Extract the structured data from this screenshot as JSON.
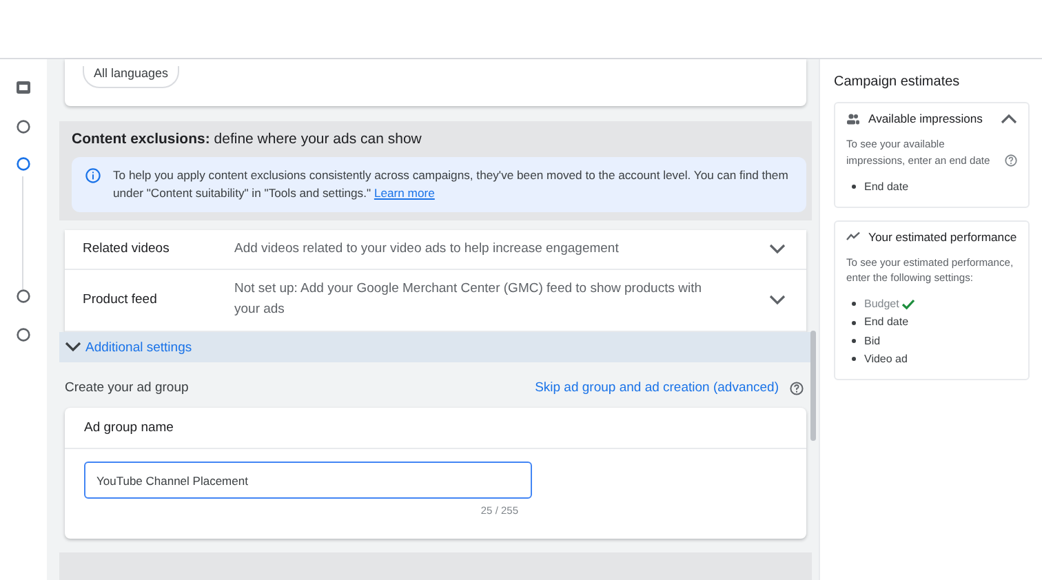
{
  "stepper": {
    "steps": [
      {
        "kind": "icon",
        "selected": false
      },
      {
        "kind": "circle",
        "selected": false
      },
      {
        "kind": "circle",
        "selected": true
      },
      {
        "kind": "circle",
        "selected": false
      },
      {
        "kind": "circle",
        "selected": false
      }
    ]
  },
  "languages": {
    "chip": "All languages"
  },
  "content_exclusions": {
    "title": "**Content exclusions:** define where your ads can show",
    "notice": "To help you apply content exclusions consistently across campaigns, they've been moved to the account level. You can find them under \"Content suitability\" in \"Tools and settings.\"",
    "link": "Learn more"
  },
  "settings_rows": [
    {
      "label": "Related videos",
      "value": "Add videos related to your video ads to help increase engagement",
      "expanded": false
    },
    {
      "label": "Product feed",
      "value": "Not set up: Add your Google Merchant Center (GMC) feed to show products with your ads",
      "expanded": false
    }
  ],
  "additional_settings": {
    "label": "Additional settings",
    "expanded": false
  },
  "ad_group": {
    "title": "Create your ad group",
    "skip_link": "Skip ad group and ad creation (advanced)",
    "name_label": "Ad group name",
    "value": "YouTube Channel Placement",
    "counter": "25 / 255"
  },
  "campaign_estimates": {
    "title": "Campaign estimates",
    "cards": [
      {
        "kind": "impressions",
        "title": "Available impressions",
        "expanded": true,
        "text": "To see your available impressions, enter an end date",
        "items": [
          {
            "label": "End date",
            "done": false
          }
        ]
      },
      {
        "kind": "performance",
        "title": "Your estimated performance",
        "text": "To see your estimated performance, enter the following settings:",
        "items": [
          {
            "label": "Budget",
            "done": true
          },
          {
            "label": "End date",
            "done": false
          },
          {
            "label": "Bid",
            "done": false
          },
          {
            "label": "Video ad",
            "done": false
          }
        ]
      }
    ]
  }
}
